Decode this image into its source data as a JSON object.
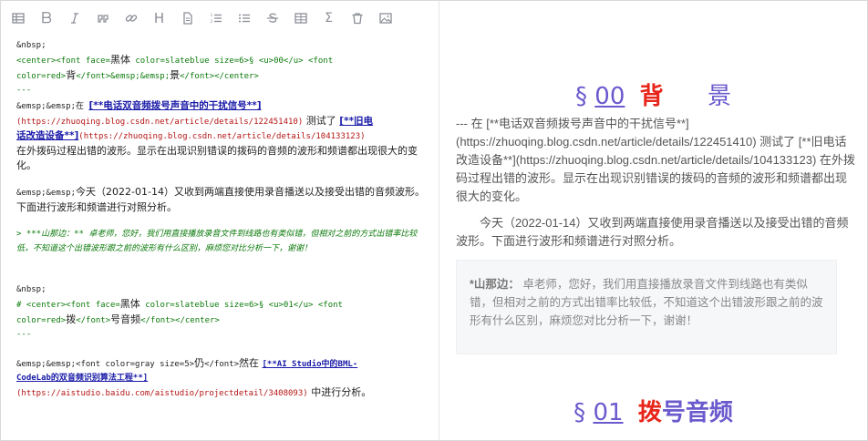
{
  "toolbar": {
    "heading_label": "H",
    "sigma_label": "Σ"
  },
  "source": {
    "l1": "&nbsp;",
    "l2a": "<center><font   face=",
    "l2b": "黑体",
    "l2c": " color=slateblue size=6>§ <u>00</u> <font",
    "l3a": "color=red>",
    "l3b": "背",
    "l3c": "</font>&emsp;&emsp;",
    "l3d": "景",
    "l3e": "</font></center>",
    "l4": "---",
    "l5a": "&emsp;&emsp;在 ",
    "l5b": "[**电话双音频拨号声音中的干扰信号**]",
    "l6a": "(https://zhuoqing.blog.csdn.net/article/details/122451410)",
    "l6b": " 测试了 ",
    "l6c": "[**旧电",
    "l7a": "话改造设备**]",
    "l7b": "(https://zhuoqing.blog.csdn.net/article/details/104133123)",
    "l8": "在外拨码过程出错的波形。显示在出现识别错误的拨码的音频的波形和频谱都出现很大的变化。",
    "l10a": "&emsp;&emsp;",
    "l10b": "今天（2022-01-14）又收到两端直接使用录音播送以及接受出错的音频波形。下面进行波形和频谱进行对照分析。",
    "l12": "> ***山那边：** 卓老师，您好，我们用直接播放录音文件到线路也有类似错，但相对之前的方式出错率比较低，不知道这个出错波形跟之前的波形有什么区别，麻烦您对比分析一下，谢谢！",
    "l14": "&nbsp;",
    "l15a": "# <center><font   face=",
    "l15b": "黑体",
    "l15c": " color=slateblue size=6>§ <u>01</u> <font",
    "l16a": "color=red>",
    "l16b": "拨",
    "l16c": "</font>",
    "l16d": "号音频",
    "l16e": "</font></center>",
    "l17": "---",
    "l19a": "&emsp;&emsp;<font color=gray size=5>",
    "l19b": "仍",
    "l19c": "</font>",
    "l19d": "然在 ",
    "l19e": "[**AI Studio中的BML-",
    "l20a": "CodeLab的双音频识别算法工程**]",
    "l21a": "(https://aistudio.baidu.com/aistudio/projectdetail/3408093)",
    "l21b": " 中进行分析。"
  },
  "preview": {
    "h1_section": "§",
    "h1_num": "00",
    "h1_red": "背",
    "h1_rest": "景",
    "p1": "---        在 [**电话双音频拨号声音中的干扰信号**](https://zhuoqing.blog.csdn.net/article/details/122451410) 测试了 [**旧电话改造设备**](https://zhuoqing.blog.csdn.net/article/details/104133123) 在外拨码过程出错的波形。显示在出现识别错误的拨码的音频的波形和频谱都出现很大的变化。",
    "p2": "今天（2022-01-14）又收到两端直接使用录音播送以及接受出错的音频波形。下面进行波形和频谱进行对照分析。",
    "quote_author": "*山那边：",
    "quote_text": " 卓老师，您好，我们用直接播放录音文件到线路也有类似错，但相对之前的方式出错率比较低，不知道这个出错波形跟之前的波形有什么区别，麻烦您对比分析一下，谢谢！",
    "h2_section": "§",
    "h2_num": "01",
    "h2_red": "拨",
    "h2_rest": "号音频"
  },
  "colors": {
    "slateblue": "#6a5acd",
    "red": "#e8251a",
    "icon": "#8b8e97"
  }
}
